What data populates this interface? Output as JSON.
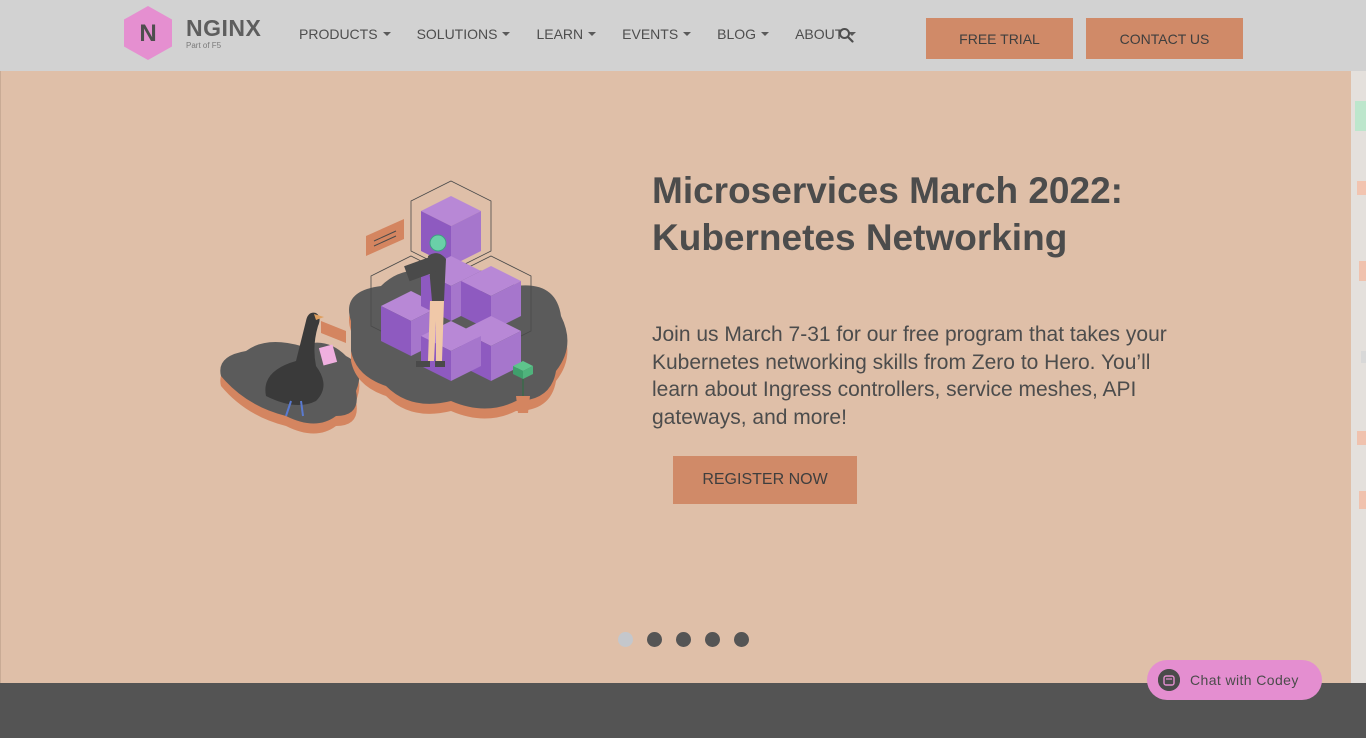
{
  "header": {
    "logo": {
      "name": "NGINX",
      "sub": "Part of F5",
      "letter": "N"
    },
    "nav": [
      {
        "label": "PRODUCTS"
      },
      {
        "label": "SOLUTIONS"
      },
      {
        "label": "LEARN"
      },
      {
        "label": "EVENTS"
      },
      {
        "label": "BLOG"
      },
      {
        "label": "ABOUT"
      }
    ],
    "search_icon": "search-icon",
    "free_trial_label": "FREE TRIAL",
    "contact_label": "CONTACT US"
  },
  "hero": {
    "title": "Microservices March 2022: Kubernetes Networking",
    "description": "Join us March 7-31 for our free program that takes your Kubernetes networking skills from Zero to Hero. You’ll learn about Ingress controllers, service meshes, API gateways, and more!",
    "register_label": "REGISTER NOW",
    "carousel": {
      "total": 5,
      "active": 1
    }
  },
  "chat": {
    "label": "Chat with Codey"
  },
  "colors": {
    "accent": "#d08a68",
    "hero_bg": "#dfbfa8",
    "logo": "#e58fd0",
    "chat": "#e48ed0",
    "footer": "#545454"
  }
}
